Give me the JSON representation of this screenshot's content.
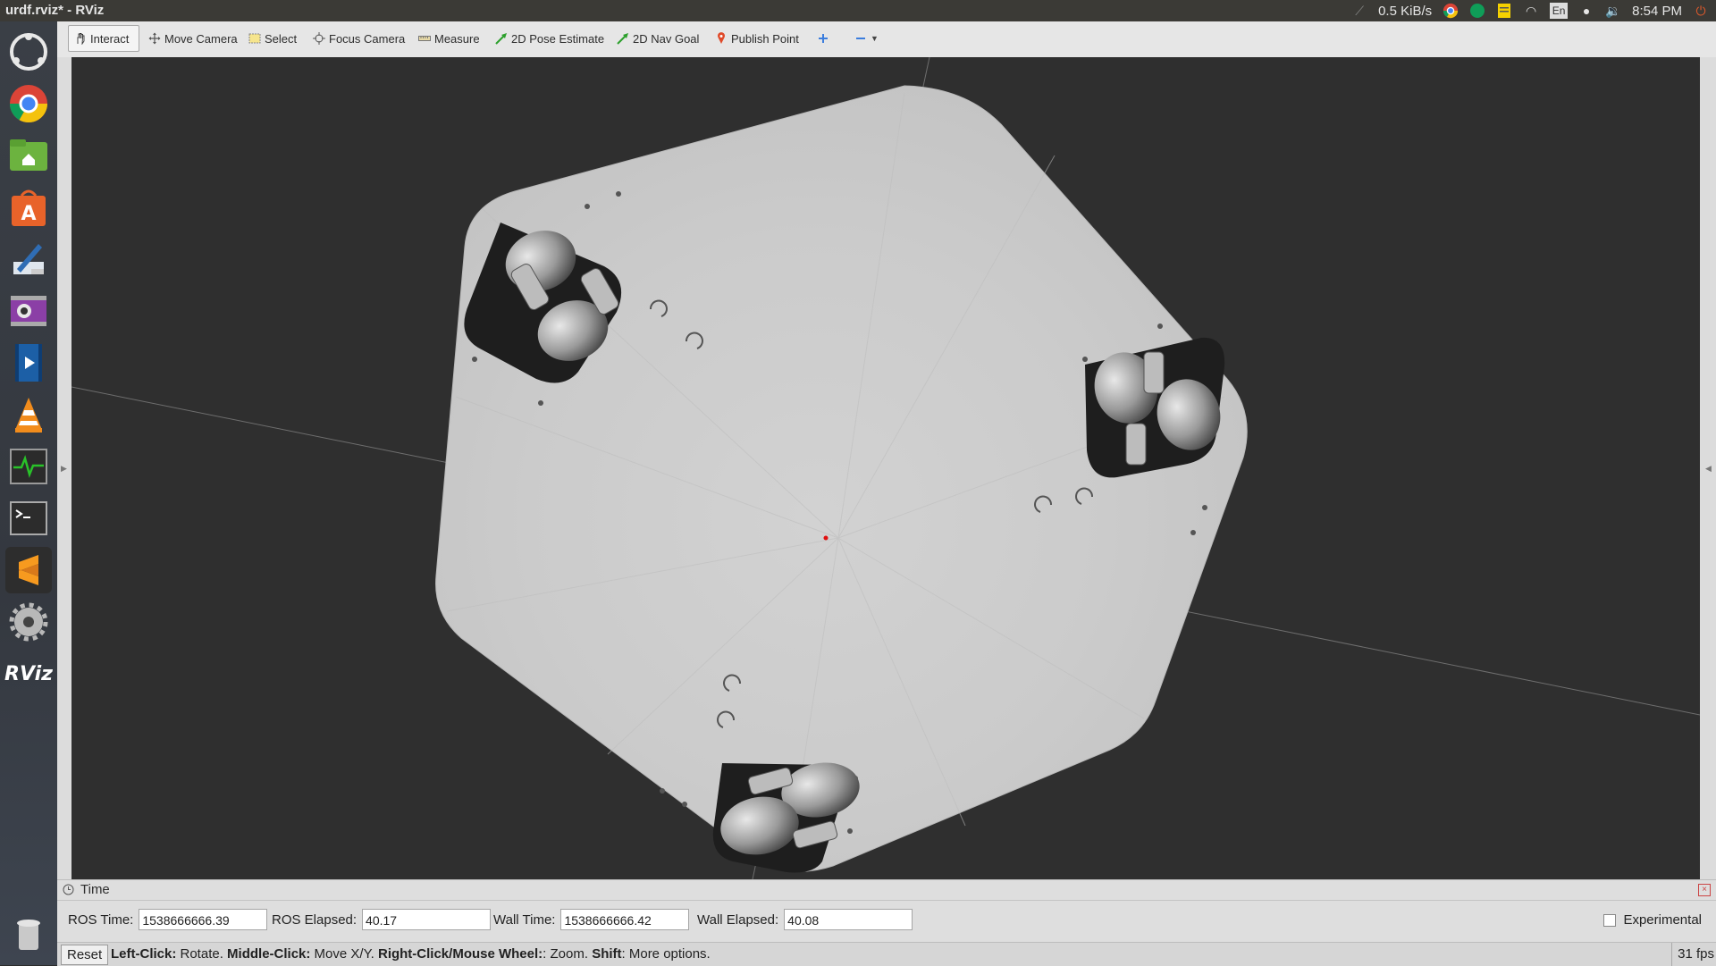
{
  "window": {
    "title": "urdf.rviz* - RViz"
  },
  "system_tray": {
    "network_speed": "0.5 KiB/s",
    "keyboard_layout": "En",
    "clock": "8:54 PM",
    "icons": [
      "network-arrow-icon",
      "chrome-tray-icon",
      "hangouts-tray-icon",
      "notes-tray-icon",
      "wifi-icon",
      "keyboard-icon",
      "messaging-icon",
      "volume-icon",
      "power-icon"
    ]
  },
  "launcher": {
    "items": [
      {
        "name": "ubuntu-dash-icon"
      },
      {
        "name": "chrome-icon"
      },
      {
        "name": "files-icon"
      },
      {
        "name": "software-center-icon"
      },
      {
        "name": "text-editor-icon"
      },
      {
        "name": "webcam-icon"
      },
      {
        "name": "video-editor-icon"
      },
      {
        "name": "vlc-icon"
      },
      {
        "name": "system-monitor-icon"
      },
      {
        "name": "terminal-icon"
      },
      {
        "name": "sublime-text-icon"
      },
      {
        "name": "settings-icon"
      },
      {
        "name": "rviz-icon",
        "label": "RViz"
      },
      {
        "name": "trash-icon"
      }
    ]
  },
  "toolbar": {
    "tools": [
      {
        "label": "Interact",
        "icon": "hand-icon",
        "active": true
      },
      {
        "label": "Move Camera",
        "icon": "move-camera-icon",
        "active": false
      },
      {
        "label": "Select",
        "icon": "select-icon",
        "active": false
      },
      {
        "label": "Focus Camera",
        "icon": "focus-camera-icon",
        "active": false
      },
      {
        "label": "Measure",
        "icon": "ruler-icon",
        "active": false
      },
      {
        "label": "2D Pose Estimate",
        "icon": "green-arrow-icon",
        "active": false
      },
      {
        "label": "2D Nav Goal",
        "icon": "green-arrow-icon",
        "active": false
      },
      {
        "label": "Publish Point",
        "icon": "pin-icon",
        "active": false
      }
    ]
  },
  "time_panel": {
    "title": "Time",
    "ros_time_label": "ROS Time:",
    "ros_time": "1538666666.39",
    "ros_elapsed_label": "ROS Elapsed:",
    "ros_elapsed": "40.17",
    "wall_time_label": "Wall Time:",
    "wall_time": "1538666666.42",
    "wall_elapsed_label": "Wall Elapsed:",
    "wall_elapsed": "40.08",
    "experimental_label": "Experimental",
    "experimental_checked": false
  },
  "status_bar": {
    "reset_label": "Reset",
    "hint_parts": [
      {
        "bold": "Left-Click:",
        "text": " Rotate. "
      },
      {
        "bold": "Middle-Click:",
        "text": " Move X/Y. "
      },
      {
        "bold": "Right-Click/Mouse Wheel:",
        "text": ": Zoom. "
      },
      {
        "bold": "Shift",
        "text": ": More options."
      }
    ],
    "fps": "31 fps"
  },
  "colors": {
    "viewport_bg": "#2f2f2f",
    "robot_plate": "#cfcfcf",
    "origin_marker": "#e01010"
  }
}
